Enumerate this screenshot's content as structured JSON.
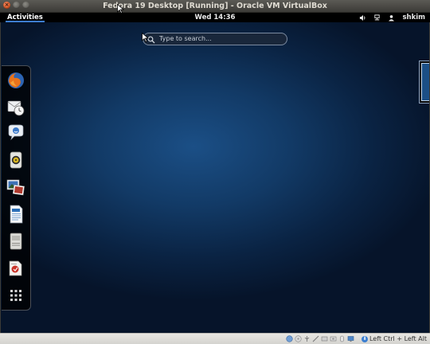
{
  "window": {
    "title": "Fedora 19 Desktop [Running] - Oracle VM VirtualBox",
    "close_glyph": "×",
    "min_glyph": "–",
    "max_glyph": "□"
  },
  "topbar": {
    "activities": "Activities",
    "clock": "Wed 14:36",
    "user": "shkim",
    "icons": [
      "volume-icon",
      "network-icon",
      "user-icon"
    ]
  },
  "search": {
    "placeholder": "Type to search..."
  },
  "dash": {
    "items": [
      "firefox-icon",
      "evolution-icon",
      "empathy-icon",
      "rhythmbox-icon",
      "shotwell-icon",
      "libreoffice-writer-icon",
      "file-manager-icon",
      "software-icon",
      "show-applications-icon"
    ]
  },
  "statusbar": {
    "icons": [
      "hard-disk-icon",
      "optical-drive-icon",
      "usb-icon",
      "shared-folders-icon",
      "network-icon",
      "capture-icon",
      "mouse-icon",
      "display-icon"
    ],
    "hostkey": "Left Ctrl + Left Alt"
  },
  "colors": {
    "accent": "#3d7dd0",
    "ubuntu_close": "#df5420",
    "desktop_center": "#1b4f86",
    "desktop_edge": "#06142a"
  }
}
